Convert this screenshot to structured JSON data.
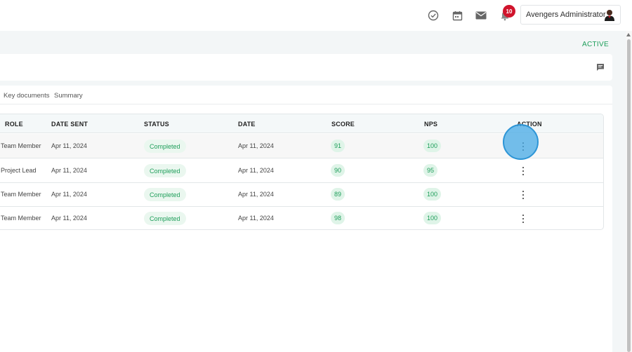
{
  "header": {
    "notification_count": "10",
    "user_name": "Avengers Administrator",
    "icons": [
      "check-circle-icon",
      "calendar-icon",
      "mail-icon",
      "bell-icon"
    ]
  },
  "status": {
    "label": "ACTIVE",
    "color": "#1e9e5a"
  },
  "tabs": [
    {
      "label": "Key documents"
    },
    {
      "label": "Summary"
    }
  ],
  "table": {
    "headers": {
      "role": "ROLE",
      "date_sent": "DATE SENT",
      "status": "STATUS",
      "date": "DATE",
      "score": "SCORE",
      "nps": "NPS",
      "action": "ACTION"
    },
    "rows": [
      {
        "role": "Team Member",
        "date_sent": "Apr 11, 2024",
        "status": "Completed",
        "date": "Apr 11, 2024",
        "score": "91",
        "nps": "100"
      },
      {
        "role": "Project Lead",
        "date_sent": "Apr 11, 2024",
        "status": "Completed",
        "date": "Apr 11, 2024",
        "score": "90",
        "nps": "95"
      },
      {
        "role": "Team Member",
        "date_sent": "Apr 11, 2024",
        "status": "Completed",
        "date": "Apr 11, 2024",
        "score": "89",
        "nps": "100"
      },
      {
        "role": "Team Member",
        "date_sent": "Apr 11, 2024",
        "status": "Completed",
        "date": "Apr 11, 2024",
        "score": "98",
        "nps": "100"
      }
    ]
  },
  "colors": {
    "accent_green": "#1e9e5a",
    "badge_red": "#d0142c",
    "click_indicator": "#2d95d6"
  }
}
